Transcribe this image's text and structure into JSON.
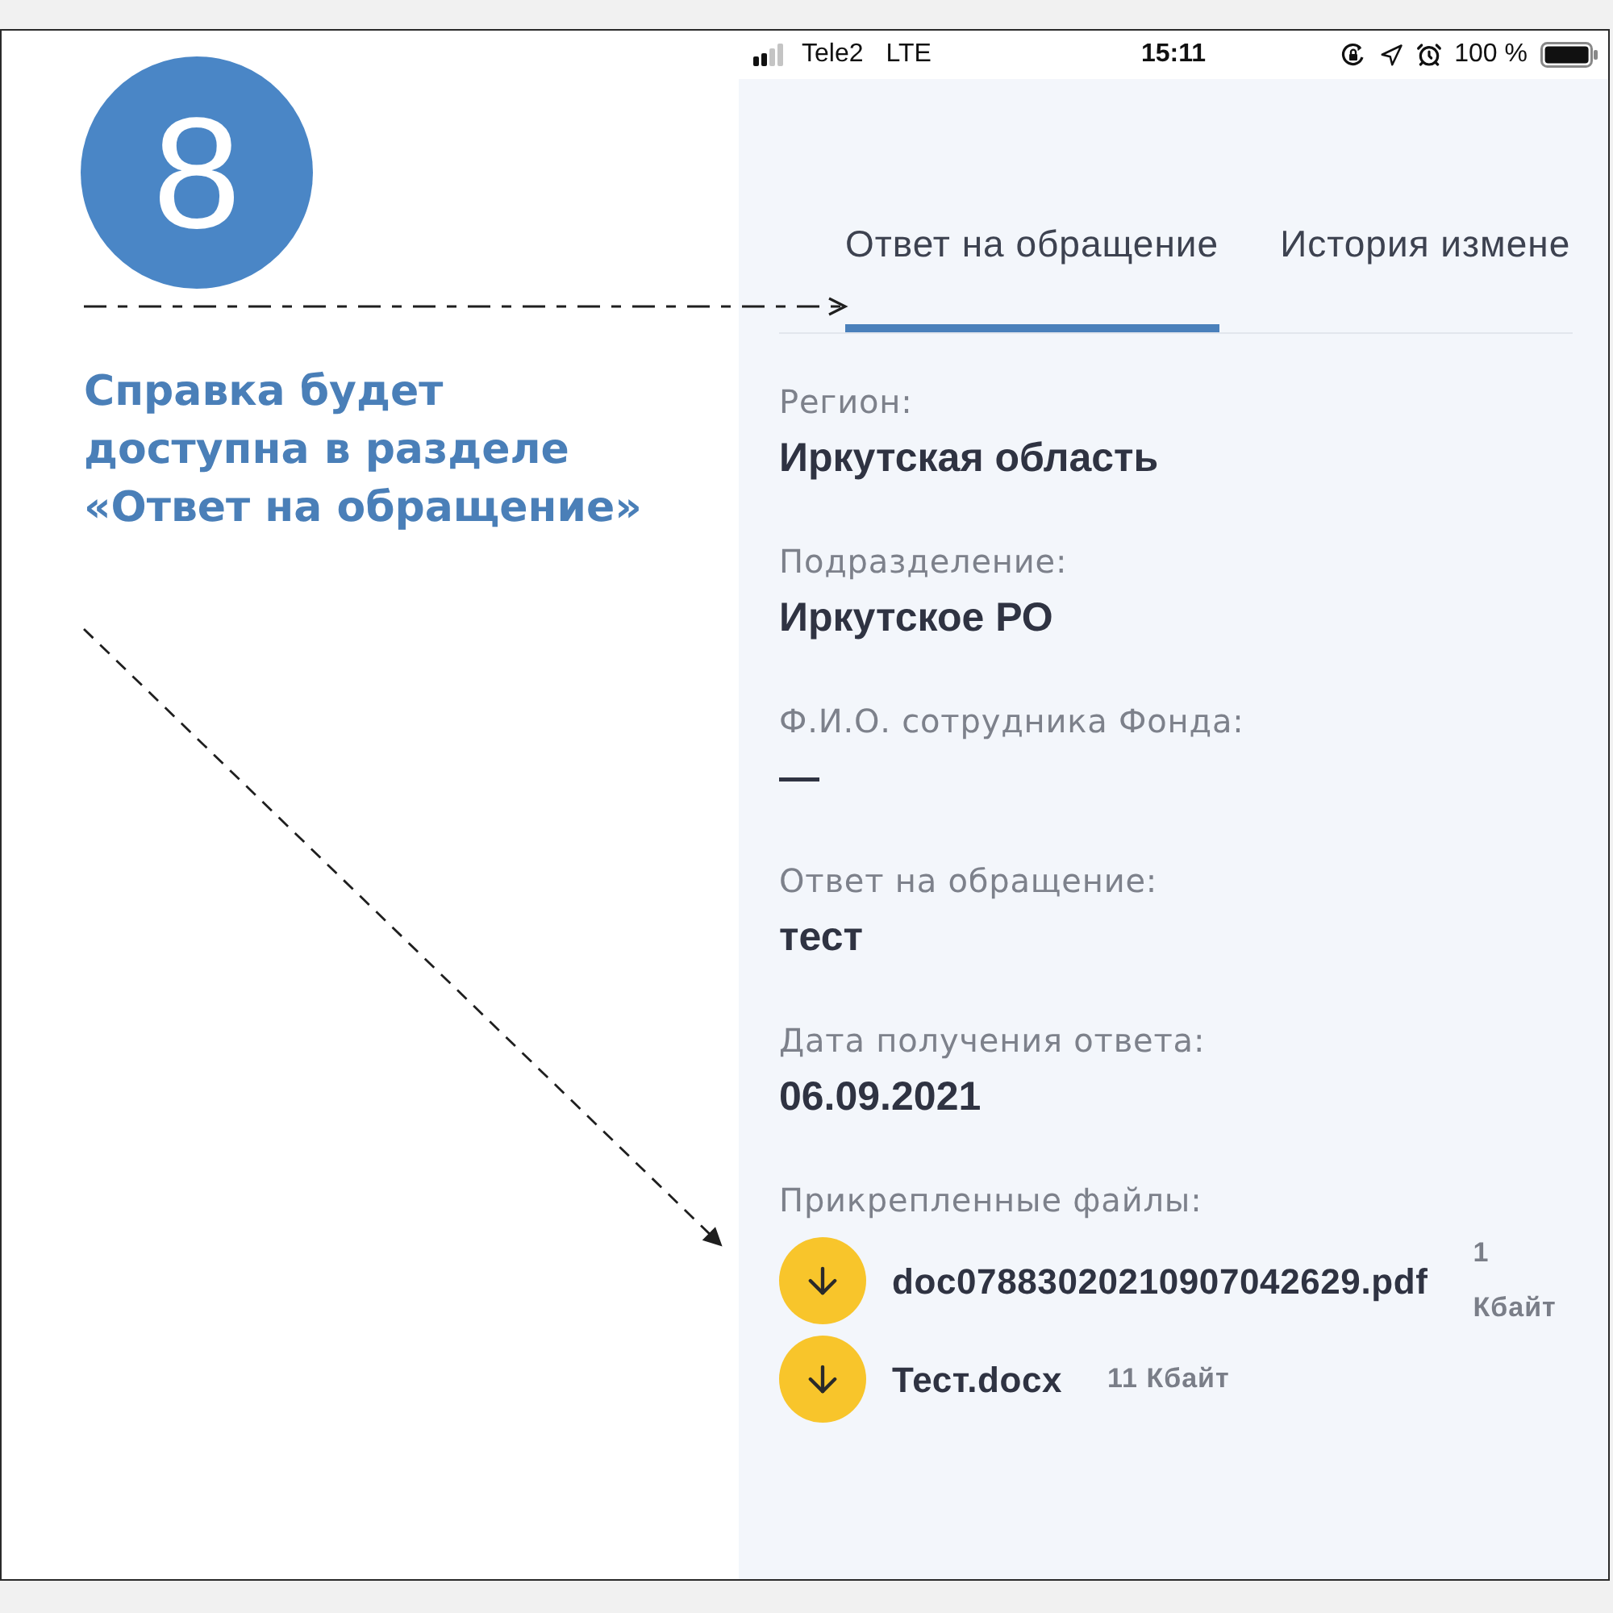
{
  "step": {
    "number": "8",
    "callout_lines": [
      "Справка будет",
      "доступна в разделе",
      "«Ответ на обращение»"
    ]
  },
  "status_bar": {
    "carrier": "Tele2",
    "network": "LTE",
    "time": "15:11",
    "battery": "100 %"
  },
  "tabs": [
    {
      "label": "Ответ на обращение",
      "selected": true
    },
    {
      "label": "История измене",
      "selected": false
    }
  ],
  "fields": [
    {
      "label": "Регион:",
      "value": "Иркутская область"
    },
    {
      "label": "Подразделение:",
      "value": "Иркутское РО"
    },
    {
      "label": "Ф.И.О. сотрудника Фонда:",
      "value": "—"
    },
    {
      "label": "Ответ на обращение:",
      "value": "тест"
    },
    {
      "label": "Дата получения ответа:",
      "value": "06.09.2021"
    }
  ],
  "attachments": {
    "label": "Прикрепленные файлы:",
    "files": [
      {
        "name": "doc07883020210907042629.pdf",
        "size": "1 Кбайт"
      },
      {
        "name": "Тест.docx",
        "size": "11 Кбайт"
      }
    ]
  }
}
